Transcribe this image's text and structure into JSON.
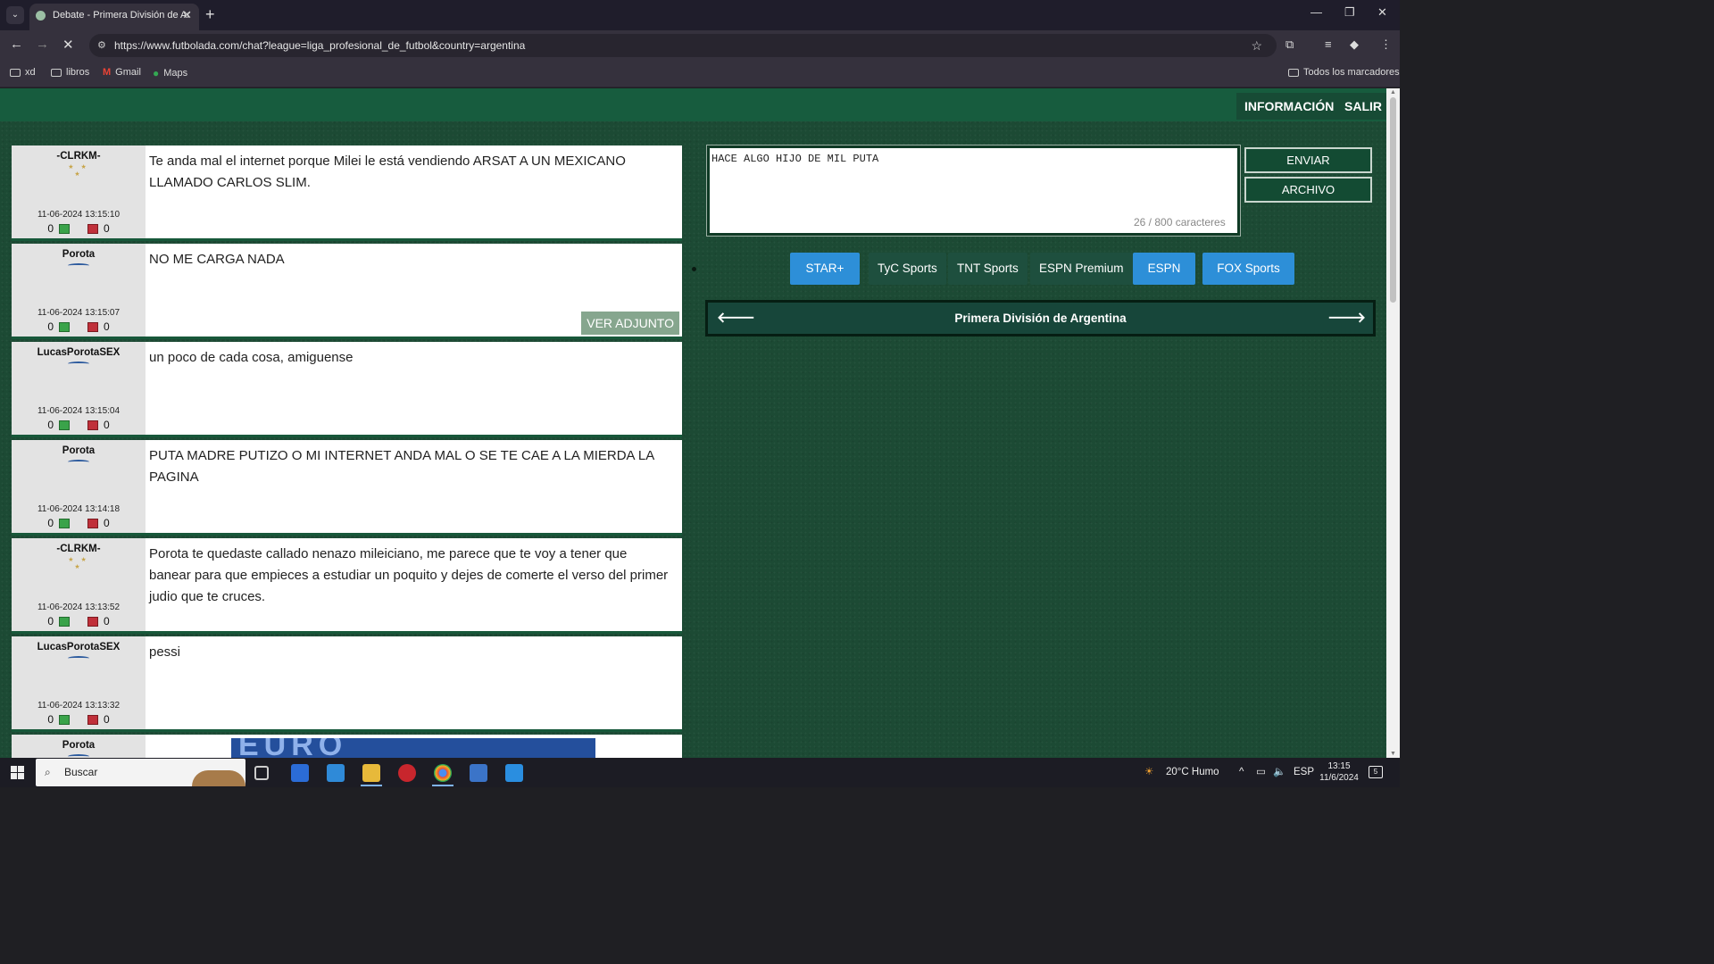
{
  "browser": {
    "tab_title": "Debate - Primera División de Ar",
    "url": "https://www.futbolada.com/chat?league=liga_profesional_de_futbol&country=argentina",
    "bookmarks": [
      {
        "label": "xd",
        "icon": "folder-icon"
      },
      {
        "label": "libros",
        "icon": "folder-icon"
      },
      {
        "label": "Gmail",
        "icon": "gmail-icon"
      },
      {
        "label": "Maps",
        "icon": "maps-icon"
      }
    ],
    "all_bookmarks": "Todos los marcadores"
  },
  "header": {
    "info_label": "INFORMACIÓN",
    "logout_label": "SALIR"
  },
  "messages": [
    {
      "user": "-CLRKM-",
      "badge": "stars",
      "date": "11-06-2024 13:15:10",
      "up": "0",
      "down": "0",
      "text": "Te anda mal el internet porque Milei le está vendiendo ARSAT A UN MEXICANO LLAMADO CARLOS SLIM."
    },
    {
      "user": "Porota",
      "badge": "wave",
      "date": "11-06-2024 13:15:07",
      "up": "0",
      "down": "0",
      "text": "NO ME CARGA NADA",
      "attachment": "VER ADJUNTO"
    },
    {
      "user": "LucasPorotaSEX",
      "badge": "wave",
      "date": "11-06-2024 13:15:04",
      "up": "0",
      "down": "0",
      "text": "un poco de cada cosa, amiguense"
    },
    {
      "user": "Porota",
      "badge": "wave",
      "date": "11-06-2024 13:14:18",
      "up": "0",
      "down": "0",
      "text": "PUTA MADRE PUTIZO O MI INTERNET ANDA MAL O SE TE CAE A LA MIERDA LA PAGINA"
    },
    {
      "user": "-CLRKM-",
      "badge": "stars",
      "date": "11-06-2024 13:13:52",
      "up": "0",
      "down": "0",
      "text": "Porota te quedaste callado nenazo mileiciano, me parece que te voy a tener que banear para que empieces a estudiar un poquito y dejes de comerte el verso del primer judio que te cruces."
    },
    {
      "user": "LucasPorotaSEX",
      "badge": "wave",
      "date": "11-06-2024 13:13:32",
      "up": "0",
      "down": "0",
      "text": "pessi"
    },
    {
      "user": "Porota",
      "badge": "wave",
      "date": "",
      "up": "",
      "down": "",
      "text": ""
    }
  ],
  "ad_banner_text": "EURO",
  "composer": {
    "value": "HACE ALGO HIJO DE MIL PUTA",
    "char_count": "26 / 800 caracteres",
    "send_label": "ENVIAR",
    "file_label": "ARCHIVO"
  },
  "channels": [
    {
      "label": "STAR+",
      "style": "blue"
    },
    {
      "label": "TyC Sports",
      "style": "dark"
    },
    {
      "label": "TNT Sports",
      "style": "dark"
    },
    {
      "label": "ESPN Premium",
      "style": "dark"
    },
    {
      "label": "ESPN",
      "style": "blue"
    },
    {
      "label": "FOX Sports",
      "style": "blue"
    }
  ],
  "league": {
    "title": "Primera División de Argentina"
  },
  "taskbar": {
    "search_placeholder": "Buscar",
    "weather": "20°C  Humo",
    "lang": "ESP",
    "time": "13:15",
    "date": "11/6/2024",
    "notifications": "5"
  },
  "colors": {
    "page_bg": "#1c4a34",
    "topbar": "#175c3e",
    "channel_blue": "#2d8fd8",
    "channel_dark": "#1e4f3e",
    "attachment_btn": "#86a68e"
  }
}
